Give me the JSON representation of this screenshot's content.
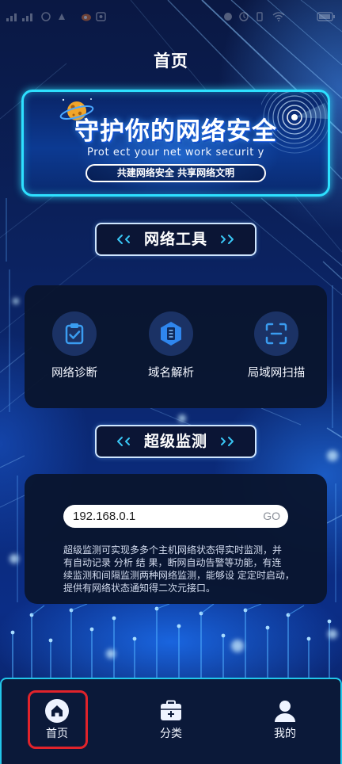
{
  "status_bar": {
    "left_icons": [
      "signal-icon",
      "signal-icon",
      "notification-icon",
      "notification-icon",
      "weibo-icon",
      "gallery-icon"
    ],
    "right_icons": [
      "nfc-icon",
      "alarm-icon",
      "vibrate-icon",
      "wifi-icon",
      "battery-icon"
    ]
  },
  "header": {
    "title": "首页"
  },
  "banner": {
    "title": "守护你的网络安全",
    "subtitle": "Prot ect your net work securit y",
    "slogan": "共建网络安全 共享网络文明",
    "icons": {
      "left": "planet-icon",
      "right": "radar-icon"
    }
  },
  "tools_section": {
    "title": "网络工具",
    "header_icons": [
      "double-chevron-left-icon",
      "double-chevron-right-icon"
    ],
    "items": [
      {
        "label": "网络诊断",
        "icon": "clipboard-check-icon"
      },
      {
        "label": "域名解析",
        "icon": "domain-resolve-icon"
      },
      {
        "label": "局域网扫描",
        "icon": "scan-icon"
      }
    ]
  },
  "monitor_section": {
    "title": "超级监测",
    "ip_input": {
      "value": "192.168.0.1"
    },
    "go_label": "GO",
    "description_lines": [
      "超级监测可实现多多个主机网络状态得实时监测，并",
      "有自动记录 分析 结 果，断网自动告警等功能，有连",
      "续监测和间隔监测两种网络监测，能够设 定定时启动，",
      "提供有网络状态通知得二次元接口。"
    ]
  },
  "bottom_nav": {
    "items": [
      {
        "label": "首页",
        "icon": "home-icon"
      },
      {
        "label": "分类",
        "icon": "category-icon"
      },
      {
        "label": "我的",
        "icon": "user-icon"
      }
    ]
  },
  "highlight": {
    "nav_index": 0,
    "color": "#e1232b"
  },
  "colors": {
    "page_background": "#0b2a78",
    "accent_cyan": "#2ee0ff",
    "nav_border": "#22c6ea",
    "icon_blue": "#3a9cf0",
    "card_background": "#0a152e",
    "icon_circle": "#1b3265",
    "input_background": "#ffffff",
    "go_text": "#8b9099",
    "highlight_red": "#e1232b",
    "text": "#ffffff"
  }
}
